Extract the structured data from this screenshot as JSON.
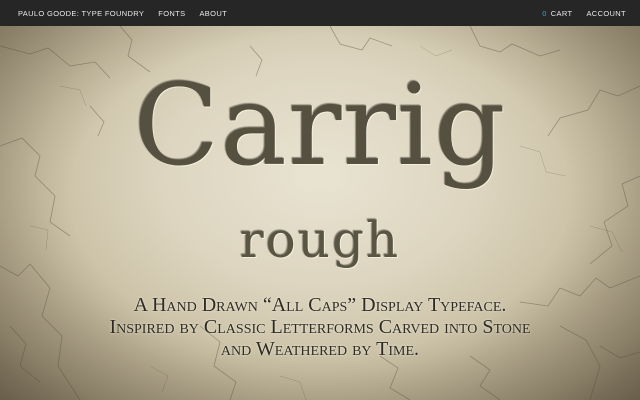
{
  "nav": {
    "brand": "PAULO GOODE: TYPE FOUNDRY",
    "fonts": "FONTS",
    "about": "ABOUT",
    "cart_count": "0",
    "cart": "CART",
    "account": "ACCOUNT"
  },
  "hero": {
    "title": "Carrig",
    "subtitle": "rough",
    "tagline": [
      "A Hand Drawn “All Caps” Display Typeface.",
      "Inspired by Classic Letterforms Carved into Stone",
      "and Weathered by Time."
    ]
  },
  "colors": {
    "nav_background": "#262626",
    "nav_text": "#e8e8e8",
    "cart_count_accent": "#2fa4d9",
    "stone_light": "#e9e3d2",
    "stone_dark": "#8a806a",
    "carved_text": "#55503f"
  }
}
